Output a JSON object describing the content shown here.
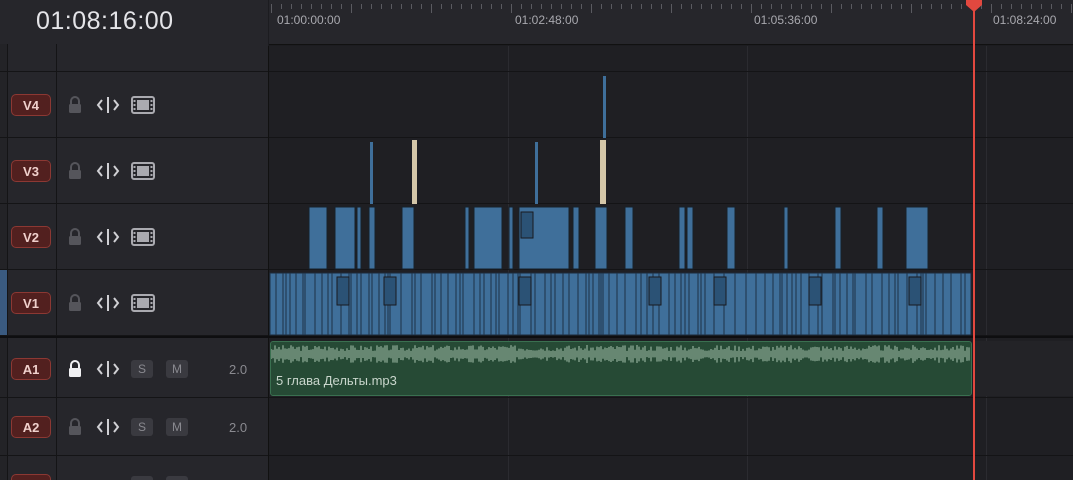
{
  "timecode": "01:08:16:00",
  "ruler": {
    "labels": [
      "01:00:00:00",
      "01:02:48:00",
      "01:05:36:00",
      "01:08:24:00"
    ]
  },
  "tracks": [
    {
      "id": "V4",
      "type": "video"
    },
    {
      "id": "V3",
      "type": "video"
    },
    {
      "id": "V2",
      "type": "video"
    },
    {
      "id": "V1",
      "type": "video"
    },
    {
      "id": "A1",
      "type": "audio",
      "format": "2.0",
      "locked": true
    },
    {
      "id": "A2",
      "type": "audio",
      "format": "2.0",
      "locked": false
    }
  ],
  "controls": {
    "solo": "S",
    "mute": "M"
  },
  "audio_clip": {
    "name": "5 глава Дельты.mp3"
  },
  "colors": {
    "video_clip": "#3f6f9a",
    "video_clip_dark": "#2b5275",
    "audio_clip": "#264a35",
    "badge": "#52201f",
    "playhead": "#e2483f",
    "title_clip": "#d4c6a8"
  },
  "icons": [
    "lock-icon",
    "trim-icon",
    "film-icon"
  ]
}
